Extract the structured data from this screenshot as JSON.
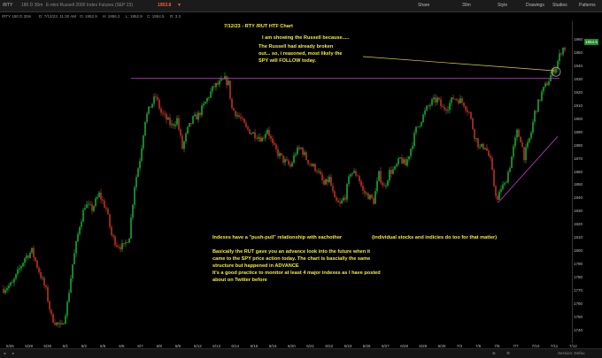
{
  "toolbar": {
    "symbol": "/RTY",
    "period": "180 D 30m",
    "description": "E-mini Russell 2000 Index Futures (SEP 23)",
    "price": "1953.8",
    "share_label": "Share",
    "timeframe": "30m",
    "style_label": "Style",
    "drawings_label": "Drawings",
    "studies_label": "Studies",
    "patterns_label": "Patterns"
  },
  "info": {
    "symbol": "/RTY 180 D 30m",
    "date": "D: 7/12/23, 11:30 AM",
    "open": "O: 1952.9",
    "high": "H: 1956.2",
    "low": "L: 1952.9",
    "close": "C: 1954.5",
    "range": "R: 3.3"
  },
  "annotations": {
    "title": "7/12/23 - RTY /RUT HTF Chart",
    "note_line1": "I am showing the Russell because.....",
    "note_line2": "The Russell had already broken",
    "note_line3": "out... so, i reasoned, most likely the",
    "note_line4": "SPY will FOLLOW today.",
    "push_pull": "Indexes have a \"push-pull\" relationship with eachother",
    "push_pull_aside": "(individual stocks and indicies do too for that matter)",
    "body_line1": "Basically the RUT gave you an advance look into the future when it",
    "body_line2": "came to the SPY price action today. The chart is bascially the same",
    "body_line3": "structure but happened in ADVANCE",
    "body_line4": "It's a good practice to monitor at least 4 major indexes as I have posted",
    "body_line5": "about on Twitter before"
  },
  "price_tag": "1954.5",
  "bottom": {
    "session": "Session: Defau"
  },
  "colors": {
    "up": "#1fbe3a",
    "down": "#d83a2a",
    "annotation": "#f2ec38",
    "resistance": "#b23bc0",
    "trendline": "#b23bc0",
    "projection": "#e0d23a"
  },
  "chart_data": {
    "type": "candlestick",
    "y_ticks": [
      1960,
      1950,
      1940,
      1930,
      1920,
      1910,
      1900,
      1890,
      1880,
      1870,
      1860,
      1850,
      1840,
      1830,
      1820,
      1810,
      1800,
      1790,
      1780,
      1770,
      1760,
      1750,
      1740
    ],
    "x_ticks": [
      "5/26",
      "5/29",
      "5/30",
      "6/1",
      "6/2",
      "6/5",
      "6/6",
      "6/7",
      "6/8",
      "6/9",
      "6/12",
      "6/13",
      "6/14",
      "6/15",
      "6/16",
      "6/20",
      "6/21",
      "6/22",
      "6/23",
      "6/26",
      "6/27",
      "6/28",
      "6/29",
      "6/30",
      "7/3",
      "7/5",
      "7/6",
      "7/7",
      "7/10",
      "7/11",
      "7/12"
    ],
    "ylim": [
      1733,
      1973
    ],
    "resistance_level": 1931,
    "last_price": 1954.5,
    "path_points": [
      [
        0,
        1770
      ],
      [
        14,
        1775
      ],
      [
        28,
        1795
      ],
      [
        36,
        1800
      ],
      [
        44,
        1785
      ],
      [
        52,
        1770
      ],
      [
        58,
        1750
      ],
      [
        64,
        1745
      ],
      [
        70,
        1742
      ],
      [
        76,
        1760
      ],
      [
        82,
        1790
      ],
      [
        90,
        1820
      ],
      [
        96,
        1835
      ],
      [
        104,
        1832
      ],
      [
        112,
        1843
      ],
      [
        120,
        1832
      ],
      [
        126,
        1812
      ],
      [
        132,
        1805
      ],
      [
        140,
        1803
      ],
      [
        146,
        1812
      ],
      [
        152,
        1850
      ],
      [
        158,
        1870
      ],
      [
        164,
        1900
      ],
      [
        170,
        1910
      ],
      [
        176,
        1917
      ],
      [
        182,
        1905
      ],
      [
        188,
        1900
      ],
      [
        194,
        1895
      ],
      [
        200,
        1900
      ],
      [
        206,
        1878
      ],
      [
        212,
        1892
      ],
      [
        218,
        1900
      ],
      [
        224,
        1903
      ],
      [
        230,
        1910
      ],
      [
        236,
        1918
      ],
      [
        242,
        1925
      ],
      [
        248,
        1927
      ],
      [
        254,
        1930
      ],
      [
        258,
        1927
      ],
      [
        262,
        1908
      ],
      [
        266,
        1905
      ],
      [
        272,
        1900
      ],
      [
        278,
        1893
      ],
      [
        284,
        1890
      ],
      [
        290,
        1888
      ],
      [
        296,
        1885
      ],
      [
        302,
        1893
      ],
      [
        308,
        1880
      ],
      [
        314,
        1874
      ],
      [
        320,
        1869
      ],
      [
        328,
        1864
      ],
      [
        334,
        1875
      ],
      [
        340,
        1878
      ],
      [
        346,
        1870
      ],
      [
        352,
        1865
      ],
      [
        358,
        1862
      ],
      [
        366,
        1850
      ],
      [
        372,
        1855
      ],
      [
        378,
        1838
      ],
      [
        384,
        1835
      ],
      [
        390,
        1842
      ],
      [
        396,
        1860
      ],
      [
        404,
        1858
      ],
      [
        410,
        1845
      ],
      [
        416,
        1842
      ],
      [
        422,
        1838
      ],
      [
        428,
        1858
      ],
      [
        434,
        1848
      ],
      [
        440,
        1860
      ],
      [
        446,
        1862
      ],
      [
        452,
        1870
      ],
      [
        458,
        1865
      ],
      [
        464,
        1878
      ],
      [
        470,
        1892
      ],
      [
        476,
        1900
      ],
      [
        482,
        1908
      ],
      [
        488,
        1913
      ],
      [
        494,
        1915
      ],
      [
        500,
        1908
      ],
      [
        506,
        1910
      ],
      [
        512,
        1916
      ],
      [
        518,
        1915
      ],
      [
        524,
        1912
      ],
      [
        530,
        1905
      ],
      [
        536,
        1888
      ],
      [
        542,
        1878
      ],
      [
        548,
        1880
      ],
      [
        554,
        1868
      ],
      [
        558,
        1850
      ],
      [
        562,
        1838
      ],
      [
        566,
        1848
      ],
      [
        570,
        1850
      ],
      [
        576,
        1865
      ],
      [
        580,
        1878
      ],
      [
        584,
        1890
      ],
      [
        588,
        1885
      ],
      [
        592,
        1872
      ],
      [
        596,
        1880
      ],
      [
        600,
        1890
      ],
      [
        604,
        1905
      ],
      [
        608,
        1912
      ],
      [
        612,
        1920
      ],
      [
        616,
        1925
      ],
      [
        620,
        1930
      ],
      [
        624,
        1936
      ],
      [
        628,
        1940
      ],
      [
        632,
        1948
      ],
      [
        635,
        1954
      ],
      [
        638,
        1954
      ]
    ]
  }
}
